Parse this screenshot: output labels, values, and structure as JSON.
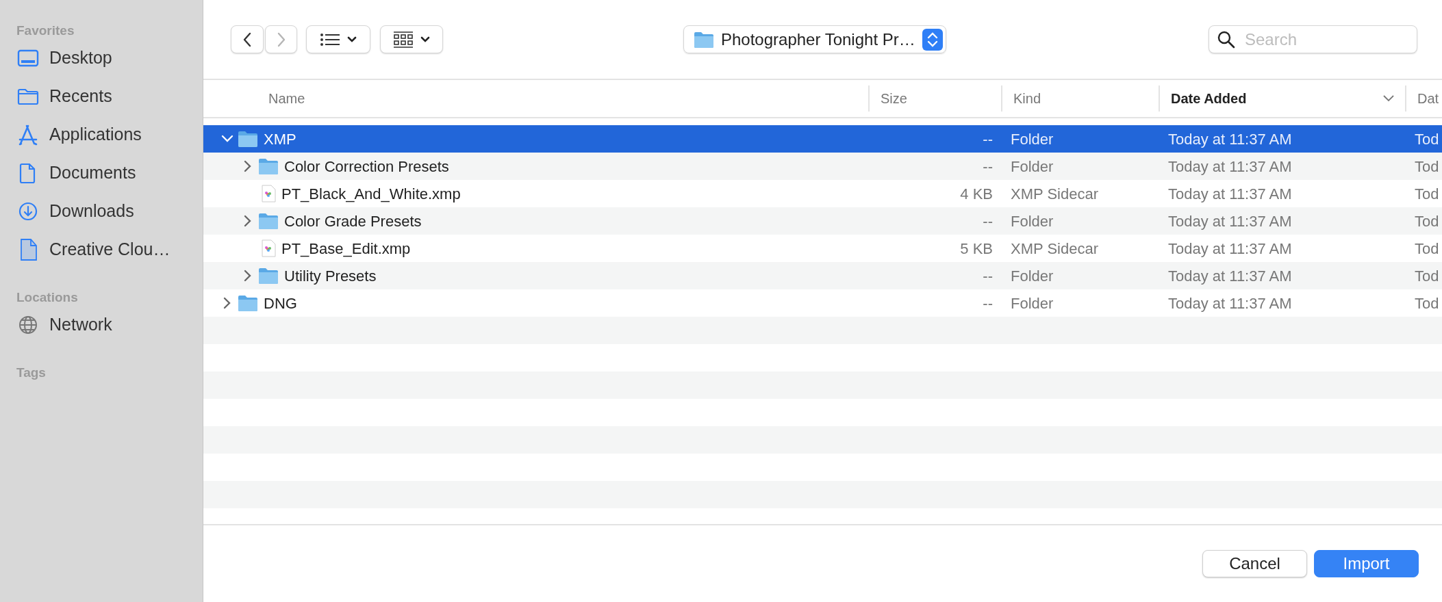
{
  "sidebar": {
    "sections": [
      {
        "title": "Favorites",
        "items": [
          {
            "label": "Desktop"
          },
          {
            "label": "Recents"
          },
          {
            "label": "Applications"
          },
          {
            "label": "Documents"
          },
          {
            "label": "Downloads"
          },
          {
            "label": "Creative Clou…"
          }
        ]
      },
      {
        "title": "Locations",
        "items": [
          {
            "label": "Network"
          }
        ]
      },
      {
        "title": "Tags"
      }
    ]
  },
  "toolbar": {
    "path": "Photographer Tonight Pr…",
    "search": {
      "placeholder": "Search"
    }
  },
  "table": {
    "columns": [
      {
        "label": "Name",
        "sorted": false
      },
      {
        "label": "Size",
        "sorted": false
      },
      {
        "label": "Kind",
        "sorted": false
      },
      {
        "label": "Date Added",
        "sorted": true
      },
      {
        "label": "Dat",
        "sorted": false
      }
    ],
    "rows": [
      {
        "kind": "folder",
        "name": "XMP",
        "size": "--",
        "file_kind": "Folder",
        "date_added": "Today at 11:37 AM",
        "column_5": "Tod",
        "selected": true,
        "expanded": true,
        "children": [
          {
            "kind": "folder",
            "name": "Color Correction Presets",
            "size": "--",
            "file_kind": "Folder",
            "date_added": "Today at 11:37 AM",
            "column_5": "Tod",
            "selected": false,
            "expanded": false
          },
          {
            "kind": "file",
            "name": "PT_Black_And_White.xmp",
            "size": "4 KB",
            "file_kind": "XMP Sidecar",
            "date_added": "Today at 11:37 AM",
            "column_5": "Tod",
            "selected": false
          },
          {
            "kind": "folder",
            "name": "Color Grade Presets",
            "size": "--",
            "file_kind": "Folder",
            "date_added": "Today at 11:37 AM",
            "column_5": "Tod",
            "selected": false,
            "expanded": false
          },
          {
            "kind": "file",
            "name": "PT_Base_Edit.xmp",
            "size": "5 KB",
            "file_kind": "XMP Sidecar",
            "date_added": "Today at 11:37 AM",
            "column_5": "Tod",
            "selected": false
          },
          {
            "kind": "folder",
            "name": "Utility Presets",
            "size": "--",
            "file_kind": "Folder",
            "date_added": "Today at 11:37 AM",
            "column_5": "Tod",
            "selected": false,
            "expanded": false
          }
        ]
      },
      {
        "kind": "folder",
        "name": "DNG",
        "size": "--",
        "file_kind": "Folder",
        "date_added": "Today at 11:37 AM",
        "column_5": "Tod",
        "selected": false,
        "expanded": false
      }
    ]
  },
  "buttons": [
    {
      "label": "Cancel",
      "kind": "secondary"
    },
    {
      "label": "Import",
      "kind": "primary"
    }
  ]
}
